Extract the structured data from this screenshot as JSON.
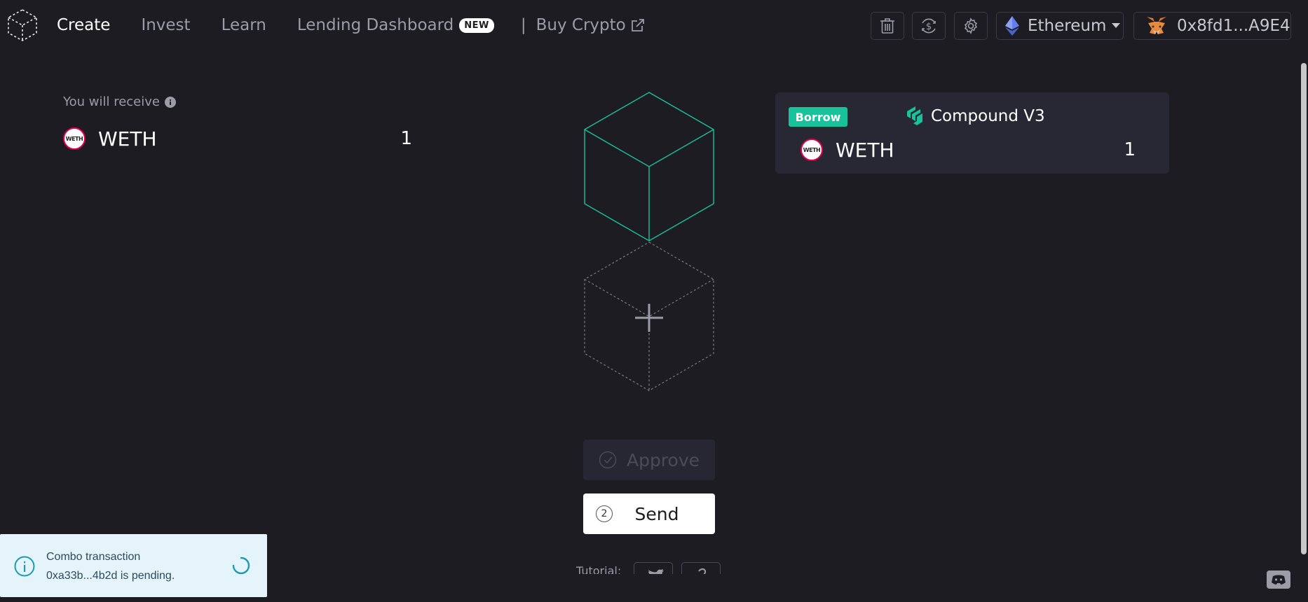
{
  "nav": {
    "items": [
      {
        "label": "Create",
        "active": true
      },
      {
        "label": "Invest",
        "active": false
      },
      {
        "label": "Learn",
        "active": false
      },
      {
        "label": "Lending Dashboard",
        "active": false,
        "badge": "NEW"
      }
    ],
    "separator": "|",
    "buy_crypto": "Buy Crypto"
  },
  "header_actions": {
    "icons": [
      "trash-icon",
      "convert-dollar-icon",
      "gear-icon"
    ],
    "network": "Ethereum",
    "wallet": "0x8fd1...A9E4"
  },
  "receive": {
    "label": "You will receive",
    "token_symbol": "WETH",
    "token_icon_text": "WETH",
    "amount": "1"
  },
  "action_card": {
    "badge": "Borrow",
    "protocol": "Compound V3",
    "token_symbol": "WETH",
    "token_icon_text": "WETH",
    "amount": "1"
  },
  "buttons": {
    "approve": "Approve",
    "send_step": "2",
    "send": "Send"
  },
  "tutorial": "Tutorial:",
  "toast": {
    "message": "Combo transaction 0xa33b...4b2d is pending."
  },
  "colors": {
    "background": "#1c1c22",
    "accent": "#18c39b",
    "card": "#272834",
    "weth_red": "#e0004d",
    "toast_bg": "#e5f4fb",
    "toast_info": "#1a9bb0"
  }
}
